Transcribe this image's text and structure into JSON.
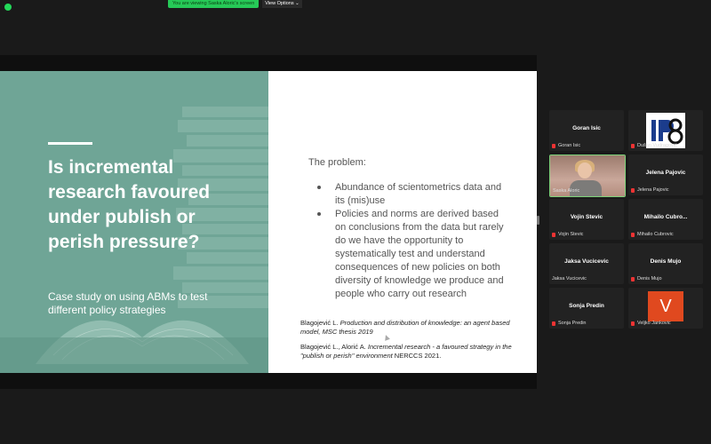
{
  "banner": {
    "viewing_text": "You are viewing Saska Aloric's screen",
    "view_options_label": "View Options ⌄"
  },
  "slide": {
    "title": "Is incremental research favoured under publish or perish pressure?",
    "subtitle": "Case study on using ABMs to test different policy strategies",
    "problem_heading": "The problem:",
    "bullets": [
      "Abundance of scientometrics data and its (mis)use",
      "Policies and norms are derived based on conclusions from the data but rarely do we have the opportunity to systematically test and understand consequences of new policies on both diversity of knowledge we produce and people who carry out research"
    ],
    "references": [
      {
        "author": "Blagojević L. ",
        "title": "Production and distribution of knowledge: an agent based model, MSC thesis 2019",
        "tail": ""
      },
      {
        "author": "Blagojević L., Alorić A. ",
        "title": "Incremental research - a favoured strategy in the \"publish or perish\" environment",
        "tail": "  NERCCS 2021."
      }
    ]
  },
  "participants": [
    {
      "display": "Goran Isic",
      "label": "Goran Isic",
      "muted": true,
      "type": "name"
    },
    {
      "display": "",
      "label": "Dušan Vudragović",
      "muted": true,
      "type": "logo"
    },
    {
      "display": "",
      "label": "Saska Aloric",
      "muted": false,
      "type": "video"
    },
    {
      "display": "Jelena Pajovic",
      "label": "Jelena Pajovic",
      "muted": true,
      "type": "name"
    },
    {
      "display": "Vojin Stevic",
      "label": "Vojin Stevic",
      "muted": true,
      "type": "name"
    },
    {
      "display": "Mihailo Cubro...",
      "label": "Mihailo Cubrovic",
      "muted": true,
      "type": "name"
    },
    {
      "display": "Jaksa Vucicevic",
      "label": "Jaksa Vucicevic",
      "muted": false,
      "type": "name"
    },
    {
      "display": "Denis Mujo",
      "label": "Denis Mujo",
      "muted": true,
      "type": "name"
    },
    {
      "display": "Sonja Predin",
      "label": "Sonja Predin",
      "muted": true,
      "type": "name"
    },
    {
      "display": "V",
      "label": "Veljko Jankovic",
      "muted": true,
      "type": "avatar"
    }
  ],
  "colors": {
    "slide_teal": "#6fa596",
    "banner_green": "#26c957",
    "mic_red": "#e33333",
    "avatar_orange": "#e0491f"
  }
}
